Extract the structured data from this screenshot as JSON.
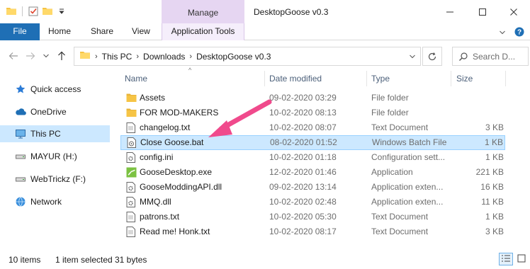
{
  "window": {
    "title": "DesktopGoose v0.3",
    "manage_label": "Manage"
  },
  "ribbon": {
    "tabs": [
      "File",
      "Home",
      "Share",
      "View"
    ],
    "contextual_tab": "Application Tools"
  },
  "address": {
    "breadcrumbs": [
      "This PC",
      "Downloads",
      "DesktopGoose v0.3"
    ],
    "search_placeholder": "Search D..."
  },
  "nav": {
    "items": [
      {
        "label": "Quick access",
        "icon": "star-icon"
      },
      {
        "label": "OneDrive",
        "icon": "cloud-icon"
      },
      {
        "label": "This PC",
        "icon": "computer-icon",
        "selected": true
      },
      {
        "label": "MAYUR (H:)",
        "icon": "drive-icon"
      },
      {
        "label": "WebTrickz (F:)",
        "icon": "drive-icon"
      },
      {
        "label": "Network",
        "icon": "network-icon"
      }
    ]
  },
  "columns": {
    "name": "Name",
    "date": "Date modified",
    "type": "Type",
    "size": "Size"
  },
  "files": [
    {
      "name": "Assets",
      "date": "09-02-2020 03:29",
      "type": "File folder",
      "size": "",
      "icon": "folder-icon"
    },
    {
      "name": "FOR MOD-MAKERS",
      "date": "10-02-2020 08:13",
      "type": "File folder",
      "size": "",
      "icon": "folder-icon"
    },
    {
      "name": "changelog.txt",
      "date": "10-02-2020 08:07",
      "type": "Text Document",
      "size": "3 KB",
      "icon": "document-icon"
    },
    {
      "name": "Close Goose.bat",
      "date": "08-02-2020 01:52",
      "type": "Windows Batch File",
      "size": "1 KB",
      "icon": "batch-file-icon",
      "selected": true
    },
    {
      "name": "config.ini",
      "date": "10-02-2020 01:18",
      "type": "Configuration sett...",
      "size": "1 KB",
      "icon": "settings-file-icon"
    },
    {
      "name": "GooseDesktop.exe",
      "date": "12-02-2020 01:46",
      "type": "Application",
      "size": "221 KB",
      "icon": "app-icon"
    },
    {
      "name": "GooseModdingAPI.dll",
      "date": "09-02-2020 13:14",
      "type": "Application exten...",
      "size": "16 KB",
      "icon": "dll-icon"
    },
    {
      "name": "MMQ.dll",
      "date": "10-02-2020 02:48",
      "type": "Application exten...",
      "size": "11 KB",
      "icon": "dll-icon"
    },
    {
      "name": "patrons.txt",
      "date": "10-02-2020 05:30",
      "type": "Text Document",
      "size": "1 KB",
      "icon": "document-icon"
    },
    {
      "name": "Read me! Honk.txt",
      "date": "10-02-2020 08:17",
      "type": "Text Document",
      "size": "3 KB",
      "icon": "document-icon"
    }
  ],
  "status": {
    "item_count": "10 items",
    "selection": "1 item selected",
    "selection_size": "31 bytes"
  },
  "colors": {
    "accent": "#1f6fb5",
    "manage_tab": "#e6d6f2",
    "selection": "#cce8ff",
    "annotation_arrow": "#f04a8c",
    "folder": "#f6c445"
  }
}
